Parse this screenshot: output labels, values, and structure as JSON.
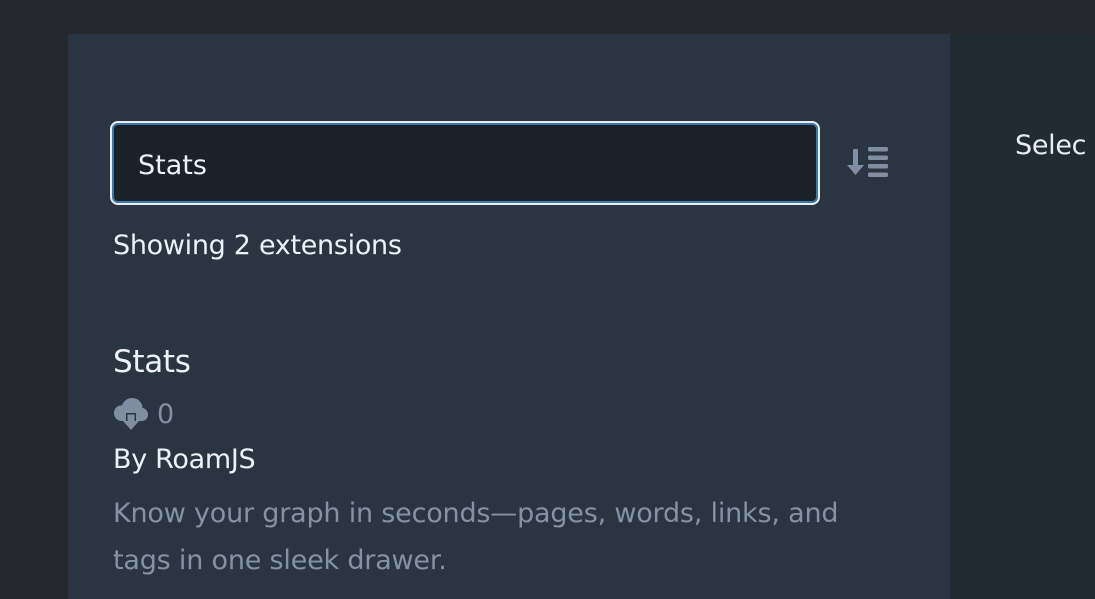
{
  "search": {
    "value": "Stats"
  },
  "results": {
    "count_text": "Showing 2 extensions"
  },
  "extension": {
    "title": "Stats",
    "downloads": "0",
    "author": "By RoamJS",
    "description": "Know your graph in seconds—pages, words, links, and tags in one sleek drawer."
  },
  "detail_pane": {
    "text": "Selec"
  },
  "icons": {
    "sort": "sort-descending-icon",
    "downloads": "cloud-download-icon"
  },
  "colors": {
    "panel_bg": "#2a3541",
    "input_bg": "#1b2129",
    "focus_ring": "#3b79a8",
    "muted_text": "#8393a4"
  }
}
